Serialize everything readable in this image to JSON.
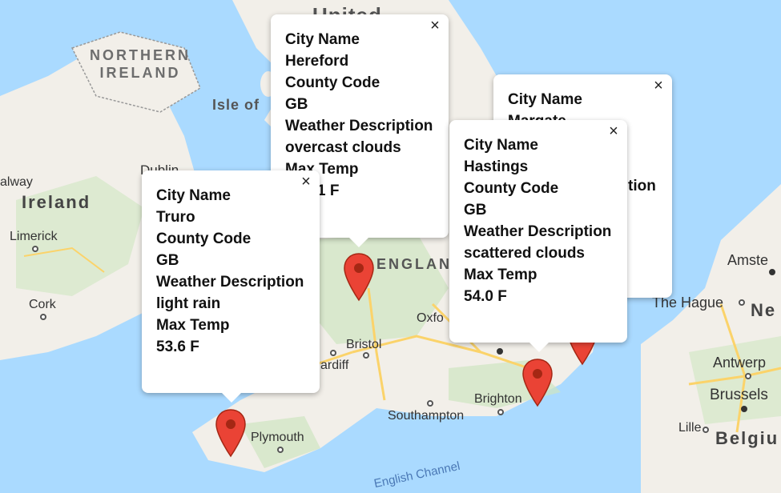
{
  "map": {
    "labels": {
      "united": "United",
      "northern_ireland": "NORTHERN\nIRELAND",
      "isle_of": "Isle of",
      "dublin": "Dublin",
      "galway": "alway",
      "ireland": "Ireland",
      "limerick": "Limerick",
      "cork": "Cork",
      "england": "ENGLAN",
      "bristol": "Bristol",
      "cardiff": "ardiff",
      "oxford": "Oxfo",
      "plymouth": "Plymouth",
      "southampton": "Southampton",
      "brighton": "Brighton",
      "english_channel": "English Channel",
      "the_hague": "The Hague",
      "amsterdam": "Amste",
      "ne": "Ne",
      "antwerp": "Antwerp",
      "brussels": "Brussels",
      "lille": "Lille",
      "belgium": "Belgiu"
    }
  },
  "popups": [
    {
      "city_label": "City Name",
      "city": "Hereford",
      "code_label": "County Code",
      "code": "GB",
      "desc_label": "Weather Description",
      "desc": "overcast clouds",
      "temp_label": "Max Temp",
      "temp": "1 F",
      "close": "×"
    },
    {
      "city_label": "City Name",
      "city": "Margate",
      "code_label": "",
      "code": "",
      "desc_label": "tion",
      "desc": "",
      "temp_label": "",
      "temp": "",
      "close": "×"
    },
    {
      "city_label": "City Name",
      "city": "Hastings",
      "code_label": "County Code",
      "code": "GB",
      "desc_label": "Weather Description",
      "desc": "scattered clouds",
      "temp_label": "Max Temp",
      "temp": "54.0 F",
      "close": "×"
    },
    {
      "city_label": "City Name",
      "city": "Truro",
      "code_label": "County Code",
      "code": "GB",
      "desc_label": "Weather Description",
      "desc": "light rain",
      "temp_label": "Max Temp",
      "temp": "53.6 F",
      "close": "×"
    }
  ],
  "colors": {
    "water": "#aadaff",
    "land": "#f2efe9",
    "green": "#cfe6c1",
    "road": "#fbd36a",
    "pin": "#ea4335",
    "pin_dark": "#a52714"
  }
}
